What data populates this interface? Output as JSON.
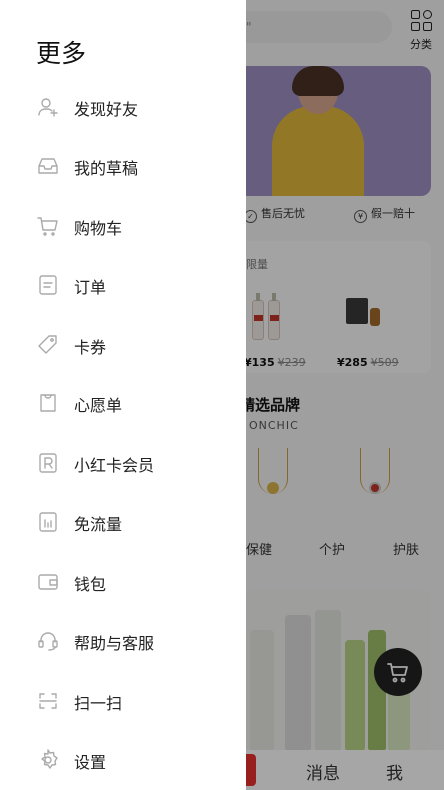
{
  "background": {
    "search_placeholder": "荅\"",
    "category_label": "分类",
    "guarantees": [
      "售后无忧",
      "假一赔十"
    ],
    "flash_tag": "限量",
    "products": [
      {
        "price": "¥135",
        "old_price": "¥239"
      },
      {
        "price": "¥285",
        "old_price": "¥509"
      }
    ],
    "brand_title": "精选品牌",
    "brand_sub": "· ONCHIC",
    "categories": [
      "保健",
      "个护",
      "护肤"
    ],
    "tabs": [
      "消息",
      "我"
    ]
  },
  "drawer": {
    "title": "更多",
    "items": [
      {
        "label": "发现好友",
        "icon": "add-friend-icon"
      },
      {
        "label": "我的草稿",
        "icon": "inbox-tray-icon"
      },
      {
        "label": "购物车",
        "icon": "cart-icon"
      },
      {
        "label": "订单",
        "icon": "order-doc-icon"
      },
      {
        "label": "卡券",
        "icon": "coupon-tag-icon"
      },
      {
        "label": "心愿单",
        "icon": "wish-bag-icon"
      },
      {
        "label": "小红卡会员",
        "icon": "r-card-icon"
      },
      {
        "label": "免流量",
        "icon": "data-bars-icon"
      },
      {
        "label": "钱包",
        "icon": "wallet-icon"
      },
      {
        "label": "帮助与客服",
        "icon": "headset-icon"
      },
      {
        "label": "扫一扫",
        "icon": "scan-icon"
      },
      {
        "label": "设置",
        "icon": "settings-gear-icon"
      }
    ]
  }
}
